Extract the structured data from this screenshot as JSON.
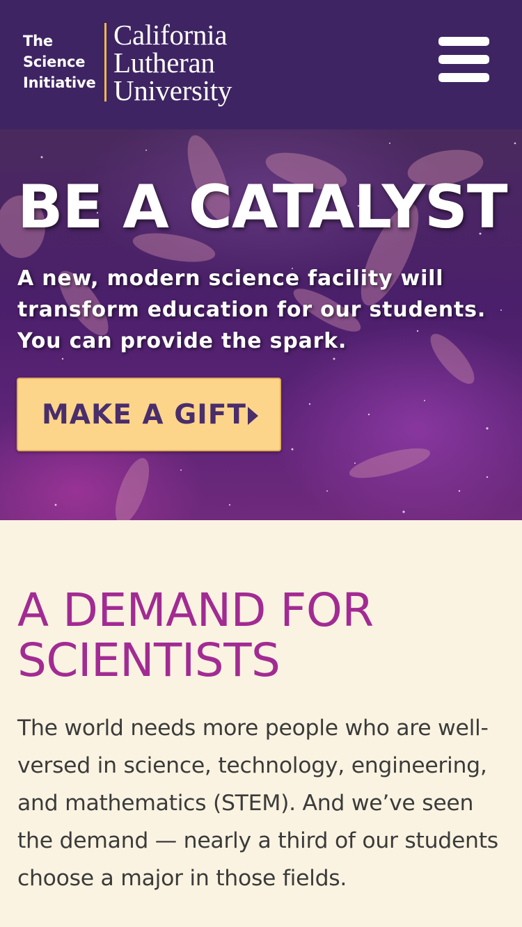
{
  "header": {
    "logo_left_lines": [
      "The",
      "Science",
      "Initiative"
    ],
    "logo_right_lines": [
      "California",
      "Lutheran",
      "University"
    ],
    "menu_icon": "hamburger-menu-icon"
  },
  "hero": {
    "title": "BE A CATALYST",
    "text": "A new, modern science facility will transform education for our students. You can provide the spark.",
    "button_label": "MAKE A GIFT",
    "button_icon": "caret-right-icon"
  },
  "section": {
    "title": "A DEMAND FOR SCIENTISTS",
    "body": "The world needs more people who are well-versed in science, technology, engineering, and mathematics (STEM). And we’ve seen the demand — nearly a third of our students choose a major in those fields."
  },
  "colors": {
    "header_bg": "#3e2462",
    "accent_gold": "#f0b84a",
    "button_bg": "#fcd58b",
    "button_text": "#4a2d6b",
    "section_title": "#a22b93",
    "page_bg": "#faf3e1",
    "body_text": "#3b3b3b"
  }
}
